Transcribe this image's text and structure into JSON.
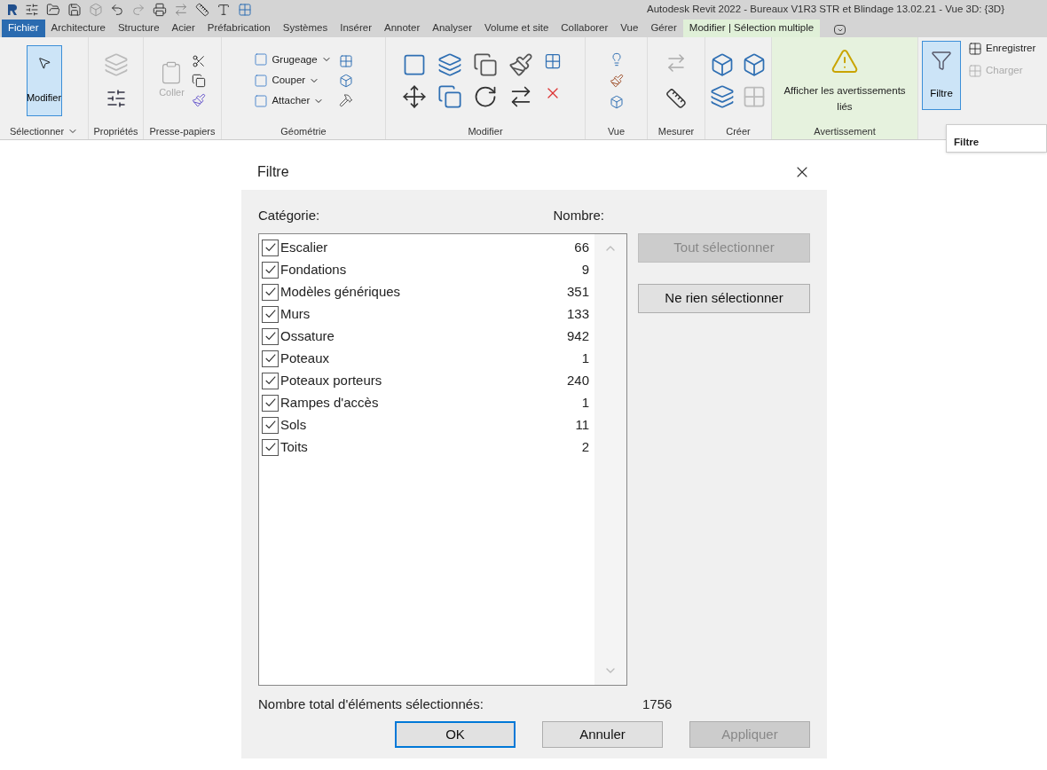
{
  "window": {
    "title": "Autodesk Revit 2022 - Bureaux V1R3 STR et Blindage 13.02.21 - Vue 3D: {3D}"
  },
  "tabs": [
    {
      "label": "Fichier",
      "kind": "file",
      "selected": false
    },
    {
      "label": "Architecture",
      "kind": "normal",
      "selected": false
    },
    {
      "label": "Structure",
      "kind": "normal",
      "selected": false
    },
    {
      "label": "Acier",
      "kind": "normal",
      "selected": false
    },
    {
      "label": "Préfabrication",
      "kind": "normal",
      "selected": false
    },
    {
      "label": "Systèmes",
      "kind": "normal",
      "selected": false
    },
    {
      "label": "Insérer",
      "kind": "normal",
      "selected": false
    },
    {
      "label": "Annoter",
      "kind": "normal",
      "selected": false
    },
    {
      "label": "Analyser",
      "kind": "normal",
      "selected": false
    },
    {
      "label": "Volume et site",
      "kind": "normal",
      "selected": false
    },
    {
      "label": "Collaborer",
      "kind": "normal",
      "selected": false
    },
    {
      "label": "Vue",
      "kind": "normal",
      "selected": false
    },
    {
      "label": "Gérer",
      "kind": "normal",
      "selected": false
    },
    {
      "label": "Modifier | Sélection multiple",
      "kind": "contextual",
      "selected": true
    }
  ],
  "ribbon": {
    "modify_button": {
      "label": "Modifier",
      "selected": true
    },
    "paste_button": {
      "label": "Coller",
      "disabled": true
    },
    "geometry_buttons": [
      {
        "label": "Grugeage"
      },
      {
        "label": "Couper"
      },
      {
        "label": "Attacher"
      }
    ],
    "warnings_button": {
      "label": "Afficher les avertissements liés"
    },
    "filter_button": {
      "label": "Filtre",
      "selected": true
    },
    "side_buttons": [
      {
        "label": "Enregistrer",
        "disabled": false
      },
      {
        "label": "Charger",
        "disabled": true
      }
    ],
    "panels": [
      {
        "label": "Sélectionner",
        "dropdown": true
      },
      {
        "label": "Propriétés",
        "dropdown": false
      },
      {
        "label": "Presse-papiers",
        "dropdown": false
      },
      {
        "label": "Géométrie",
        "dropdown": false
      },
      {
        "label": "Modifier",
        "dropdown": false
      },
      {
        "label": "Vue",
        "dropdown": false
      },
      {
        "label": "Mesurer",
        "dropdown": false
      },
      {
        "label": "Créer",
        "dropdown": false
      },
      {
        "label": "Avertissement",
        "dropdown": false
      }
    ],
    "tooltip": {
      "title": "Filtre"
    }
  },
  "dialog": {
    "title": "Filtre",
    "category_header": "Catégorie:",
    "count_header": "Nombre:",
    "categories": [
      {
        "name": "Escalier",
        "count": "66",
        "checked": true
      },
      {
        "name": "Fondations",
        "count": "9",
        "checked": true
      },
      {
        "name": "Modèles génériques",
        "count": "351",
        "checked": true
      },
      {
        "name": "Murs",
        "count": "133",
        "checked": true
      },
      {
        "name": "Ossature",
        "count": "942",
        "checked": true
      },
      {
        "name": "Poteaux",
        "count": "1",
        "checked": true
      },
      {
        "name": "Poteaux porteurs",
        "count": "240",
        "checked": true
      },
      {
        "name": "Rampes d'accès",
        "count": "1",
        "checked": true
      },
      {
        "name": "Sols",
        "count": "11",
        "checked": true
      },
      {
        "name": "Toits",
        "count": "2",
        "checked": true
      }
    ],
    "side_buttons": [
      {
        "label": "Tout sélectionner",
        "disabled": true
      },
      {
        "label": "Ne rien sélectionner",
        "disabled": false
      }
    ],
    "total_label": "Nombre total d'éléments sélectionnés:",
    "total_value": "1756",
    "buttons": [
      {
        "label": "OK",
        "kind": "default",
        "disabled": false
      },
      {
        "label": "Annuler",
        "kind": "normal",
        "disabled": false
      },
      {
        "label": "Appliquer",
        "kind": "normal",
        "disabled": true
      }
    ]
  }
}
